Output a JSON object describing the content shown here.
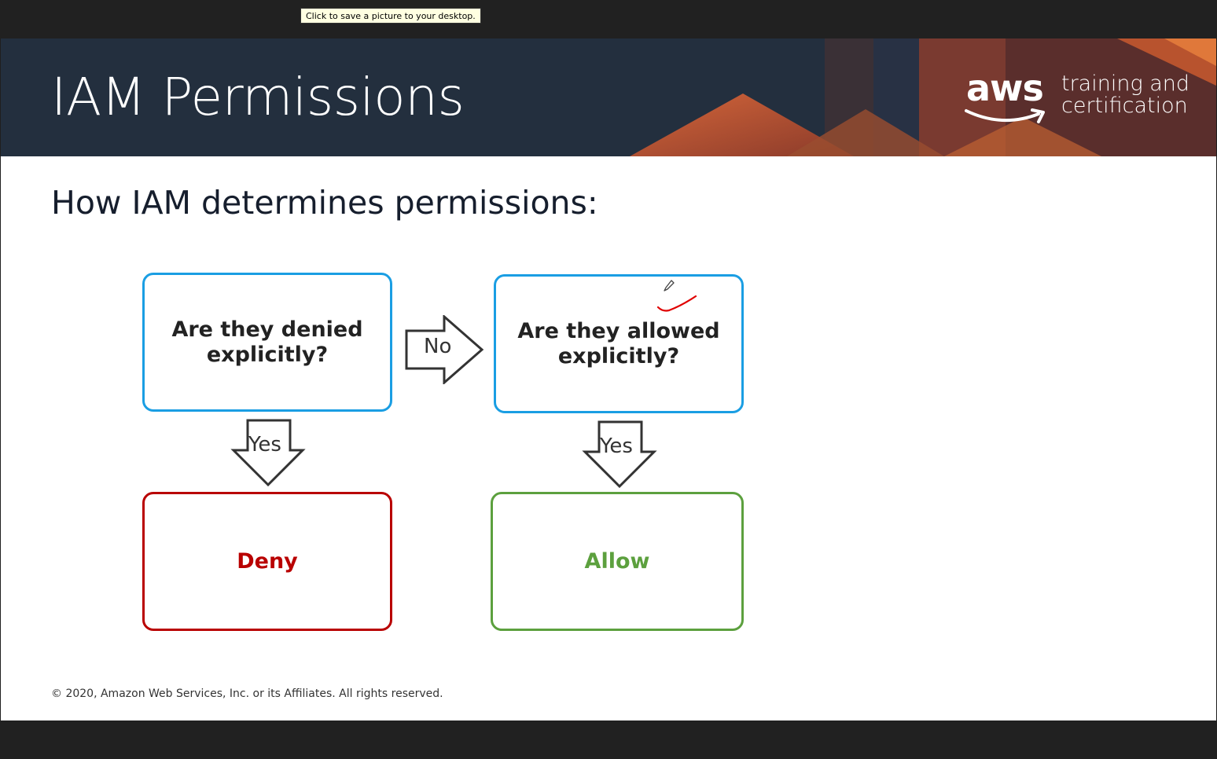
{
  "tooltip": "Click to save a picture to your desktop.",
  "slide": {
    "title": "IAM Permissions",
    "logo": {
      "aws": "aws",
      "line1": "training and",
      "line2": "certification"
    },
    "subtitle": "How IAM determines permissions:",
    "flow": {
      "q1": {
        "line1": "Are they denied",
        "line2": "explicitly?"
      },
      "q2": {
        "line1": "Are they allowed",
        "line2": "explicitly?"
      },
      "arrow_no": "No",
      "arrow_yes_1": "Yes",
      "arrow_yes_2": "Yes",
      "deny": "Deny",
      "allow": "Allow"
    },
    "footer": "© 2020, Amazon Web Services, Inc. or its Affiliates. All rights reserved."
  },
  "colors": {
    "header_bg": "#232f3e",
    "question_border": "#1a9ee3",
    "deny": "#b90000",
    "allow": "#5ca03e",
    "annotation": "#e00000"
  },
  "icons": [
    "pencil-cursor-icon",
    "aws-smile-icon"
  ]
}
